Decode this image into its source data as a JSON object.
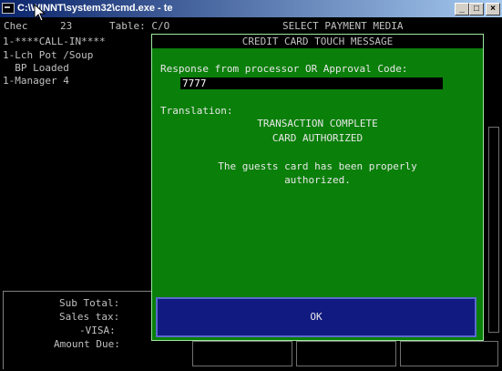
{
  "window": {
    "title": "C:\\WINNT\\system32\\cmd.exe - te",
    "minimize_glyph": "_",
    "maximize_glyph": "□",
    "close_glyph": "×"
  },
  "header": {
    "check_label": "Chec",
    "check_number": "23",
    "table_label": "Table: C/O",
    "screen_title": "SELECT PAYMENT MEDIA"
  },
  "order_lines": [
    "1-****CALL-IN****",
    "1-Lch Pot /Soup",
    "  BP Loaded",
    "1-Manager 4"
  ],
  "totals": {
    "sub_total_label": "Sub Total:",
    "sales_tax_label": "Sales tax:",
    "visa_label": "-VISA:",
    "amount_due_label": "Amount Due:"
  },
  "dialog": {
    "title": "CREDIT CARD TOUCH MESSAGE",
    "response_label": "Response from processor OR Approval Code:",
    "response_value": "7777",
    "translation_label": "Translation:",
    "translation_line1": "TRANSACTION COMPLETE",
    "translation_line2": "CARD AUTHORIZED",
    "message_line1": "The guests card has been properly",
    "message_line2": "authorized.",
    "ok_label": "OK"
  },
  "colors": {
    "dialog_bg": "#0a7f0a",
    "ok_button_bg": "#101a80",
    "console_bg": "#000000",
    "titlebar_start": "#0a246a"
  }
}
